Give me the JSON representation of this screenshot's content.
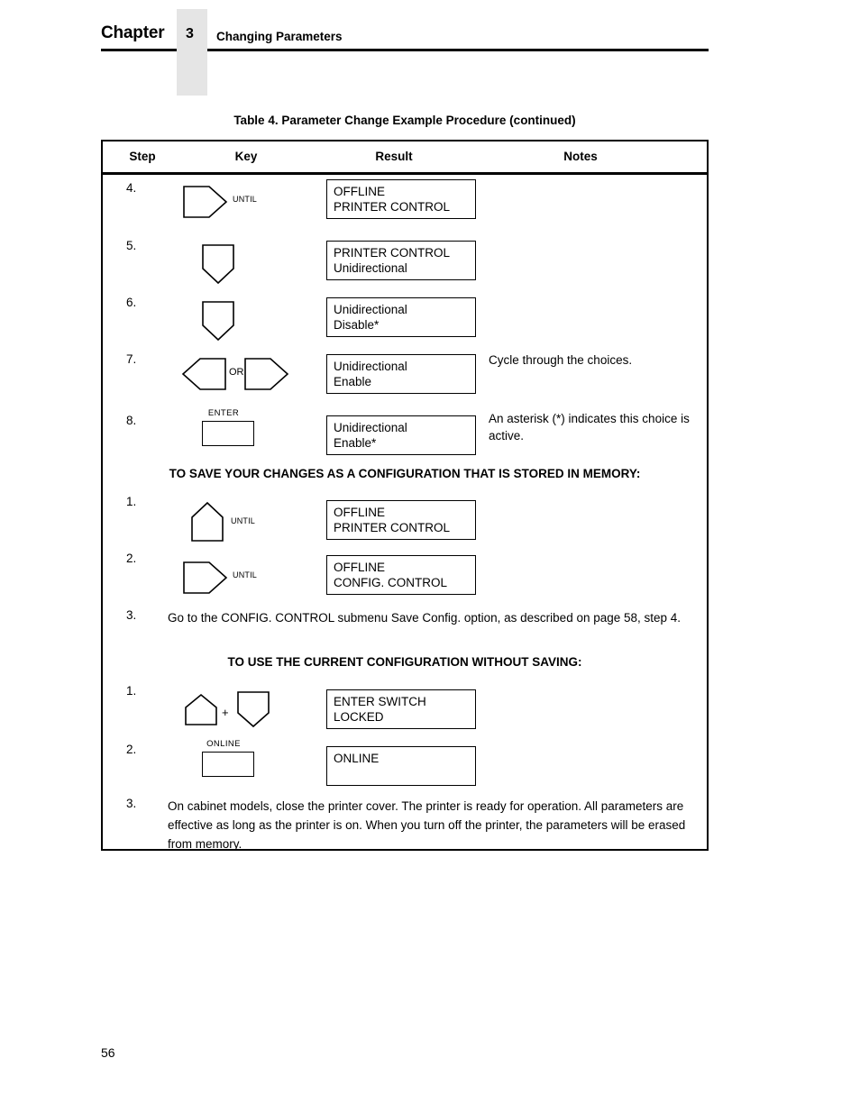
{
  "header": {
    "chapter_word": "Chapter",
    "chapter_number": "3",
    "subject": "Changing Parameters"
  },
  "table": {
    "caption": "Table 4. Parameter Change Example Procedure (continued)",
    "columns": [
      "Step",
      "Key",
      "Result",
      "Notes"
    ],
    "rows": [
      {
        "step": "4.",
        "key": {
          "type": "right-arrow-key",
          "suffix_label": "UNTIL"
        },
        "result": [
          "OFFLINE",
          "PRINTER CONTROL"
        ],
        "note": ""
      },
      {
        "step": "5.",
        "key": {
          "type": "down-arrow-key",
          "suffix_label": ""
        },
        "result": [
          "PRINTER CONTROL",
          "Unidirectional"
        ],
        "note": ""
      },
      {
        "step": "6.",
        "key": {
          "type": "down-arrow-key",
          "suffix_label": ""
        },
        "result": [
          "Unidirectional",
          "Disable*"
        ],
        "note": ""
      },
      {
        "step": "7.",
        "key": {
          "type": "left-or-right-arrow-keys",
          "join_label": "OR"
        },
        "result": [
          "Unidirectional",
          "Enable"
        ],
        "note": "Cycle through the choices."
      },
      {
        "step": "8.",
        "key": {
          "type": "enter-key",
          "top_label": "ENTER"
        },
        "result": [
          "Unidirectional",
          "Enable*"
        ],
        "note": "An asterisk (*) indicates this choice is active."
      }
    ],
    "section_save": {
      "heading": "TO SAVE YOUR CHANGES AS A CONFIGURATION THAT IS STORED IN MEMORY:",
      "rows": [
        {
          "step": "1.",
          "key": {
            "type": "up-arrow-key",
            "suffix_label": "UNTIL"
          },
          "result": [
            "OFFLINE",
            "PRINTER CONTROL"
          ],
          "note": ""
        },
        {
          "step": "2.",
          "key": {
            "type": "right-arrow-key",
            "suffix_label": "UNTIL"
          },
          "result": [
            "OFFLINE",
            "CONFIG. CONTROL"
          ],
          "note": ""
        }
      ],
      "paragraph": {
        "step": "3.",
        "text": "Go to the CONFIG. CONTROL submenu Save Config. option, as described on page 58, step 4."
      }
    },
    "section_nosave": {
      "heading": "TO USE THE CURRENT CONFIGURATION WITHOUT SAVING:",
      "rows": [
        {
          "step": "1.",
          "key": {
            "type": "up-plus-down-arrow-keys",
            "join_label": "+"
          },
          "result": [
            "ENTER SWITCH",
            "LOCKED"
          ],
          "note": ""
        },
        {
          "step": "2.",
          "key": {
            "type": "online-key",
            "top_label": "ONLINE"
          },
          "result": [
            "ONLINE",
            ""
          ],
          "note": ""
        }
      ],
      "paragraph": {
        "step": "3.",
        "text": "On cabinet models, close the printer cover. The printer is ready for operation. All parameters are effective as long as the printer is on. When you turn off the printer, the parameters will be erased from memory."
      }
    }
  },
  "footer": {
    "page_number": "56"
  }
}
